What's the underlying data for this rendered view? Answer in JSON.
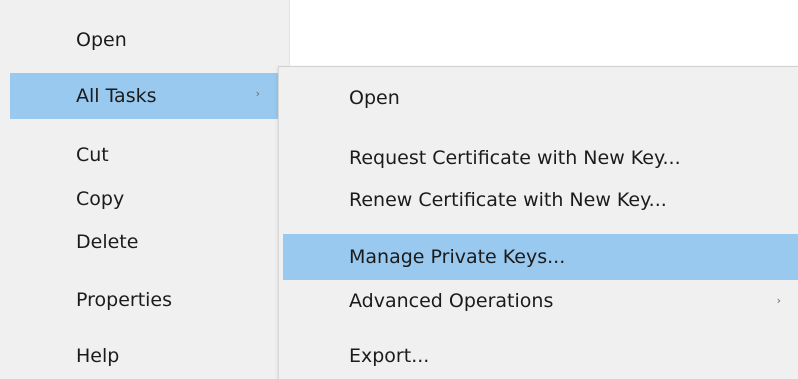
{
  "context_menu": {
    "items": [
      {
        "label": "Open"
      },
      {
        "label": "All Tasks",
        "submenu_arrow": "›"
      },
      {
        "label": "Cut"
      },
      {
        "label": "Copy"
      },
      {
        "label": "Delete"
      },
      {
        "label": "Properties"
      },
      {
        "label": "Help"
      }
    ],
    "highlight_color": "#99c9ef",
    "background_color": "#f0f0f0"
  },
  "submenu": {
    "items": [
      {
        "label": "Open"
      },
      {
        "label": "Request Certificate with New Key..."
      },
      {
        "label": "Renew Certificate with New Key..."
      },
      {
        "label": "Manage Private Keys..."
      },
      {
        "label": "Advanced Operations",
        "submenu_arrow": "›"
      },
      {
        "label": "Export..."
      }
    ]
  }
}
